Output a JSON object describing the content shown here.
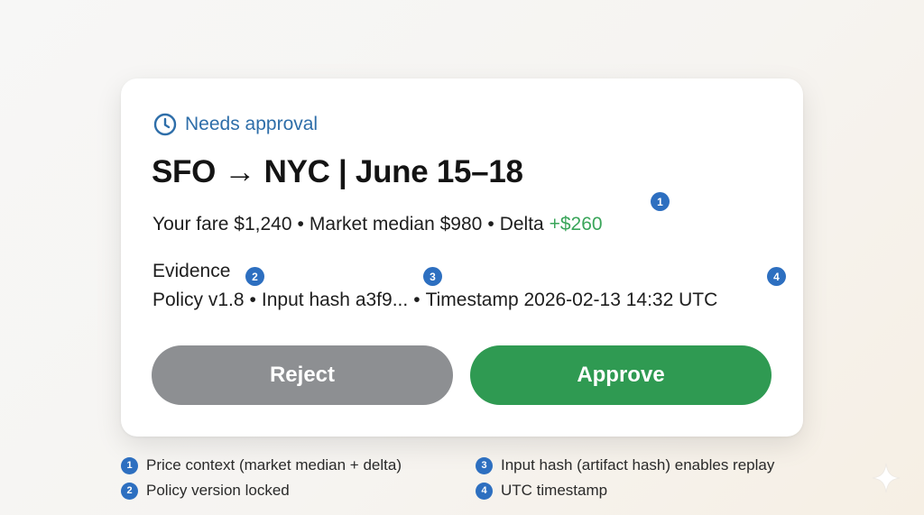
{
  "card": {
    "status": "Needs approval",
    "title": "SFO → NYC | June 15–18",
    "fare": {
      "your_fare": "Your fare $1,240",
      "market_median": "Market median $980",
      "delta_label": "Delta",
      "delta_value": "+$260"
    },
    "evidence": {
      "label": "Evidence",
      "policy": "Policy v1.8",
      "input_hash": "Input hash a3f9...",
      "timestamp": "Timestamp 2026-02-13 14:32 UTC"
    },
    "separator": "•",
    "badges": [
      "1",
      "2",
      "3",
      "4"
    ],
    "buttons": {
      "reject": "Reject",
      "approve": "Approve"
    }
  },
  "legend": [
    {
      "number": "1",
      "text": "Price context (market median + delta)"
    },
    {
      "number": "2",
      "text": "Policy version locked"
    },
    {
      "number": "3",
      "text": "Input hash (artifact hash) enables replay"
    },
    {
      "number": "4",
      "text": "UTC timestamp"
    }
  ],
  "colors": {
    "accent_blue": "#2e6ea9",
    "badge_blue": "#2d6fc0",
    "approve_green": "#2f9a52",
    "delta_green": "#3aa55a",
    "reject_gray": "#8d8f92"
  },
  "icons": {
    "status": "clock-icon",
    "corner": "sparkle-icon"
  }
}
